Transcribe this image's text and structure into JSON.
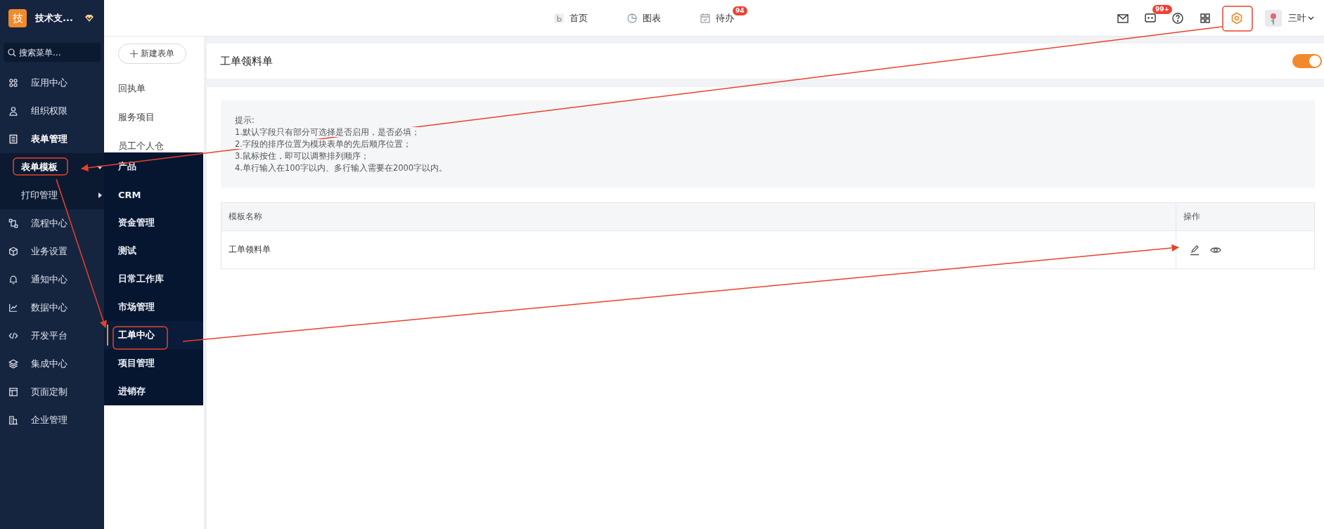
{
  "logo": {
    "mark": "技",
    "name": "技术支..."
  },
  "search": {
    "placeholder": "搜索菜单..."
  },
  "sidebar": {
    "items": [
      {
        "label": "应用中心",
        "expanded": false
      },
      {
        "label": "组织权限",
        "expanded": false
      },
      {
        "label": "表单管理",
        "expanded": true,
        "children": [
          {
            "label": "表单模板",
            "selected": true,
            "expanded": true
          },
          {
            "label": "打印管理",
            "selected": false,
            "expanded": false
          }
        ]
      },
      {
        "label": "流程中心",
        "expanded": false
      },
      {
        "label": "业务设置",
        "expanded": false
      },
      {
        "label": "通知中心",
        "expanded": false
      },
      {
        "label": "数据中心",
        "expanded": false
      },
      {
        "label": "开发平台",
        "expanded": false
      },
      {
        "label": "集成中心",
        "expanded": false
      },
      {
        "label": "页面定制",
        "expanded": false
      },
      {
        "label": "企业管理",
        "expanded": false
      }
    ]
  },
  "flyout": {
    "items": [
      {
        "label": "产品",
        "selected": false
      },
      {
        "label": "CRM",
        "selected": false
      },
      {
        "label": "资金管理",
        "selected": false
      },
      {
        "label": "测试",
        "selected": false
      },
      {
        "label": "日常工作库",
        "selected": false
      },
      {
        "label": "市场管理",
        "selected": false
      },
      {
        "label": "工单中心",
        "selected": true
      },
      {
        "label": "项目管理",
        "selected": false
      },
      {
        "label": "进销存",
        "selected": false
      }
    ]
  },
  "topbar": {
    "nav": [
      {
        "label": "首页"
      },
      {
        "label": "图表"
      },
      {
        "label": "待办",
        "badge": "94"
      }
    ],
    "chat_badge": "99+",
    "settings_selected": true,
    "user": "三叶"
  },
  "forms_panel": {
    "new_button": "新建表单",
    "items": [
      {
        "label": "回执单"
      },
      {
        "label": "服务项目"
      },
      {
        "label": "员工个人仓"
      }
    ]
  },
  "page": {
    "title": "工单领料单",
    "enabled": true,
    "hint": {
      "title": "提示:",
      "lines": [
        "1.默认字段只有部分可选择是否启用，是否必填；",
        "2.字段的排序位置为模块表单的先后顺序位置；",
        "3.鼠标按住，即可以调整排列顺序；",
        "4.单行输入在100字以内、多行输入需要在2000字以内。"
      ]
    },
    "table": {
      "columns": [
        "模板名称",
        "操作"
      ],
      "rows": [
        {
          "name": "工单领料单"
        }
      ]
    }
  }
}
